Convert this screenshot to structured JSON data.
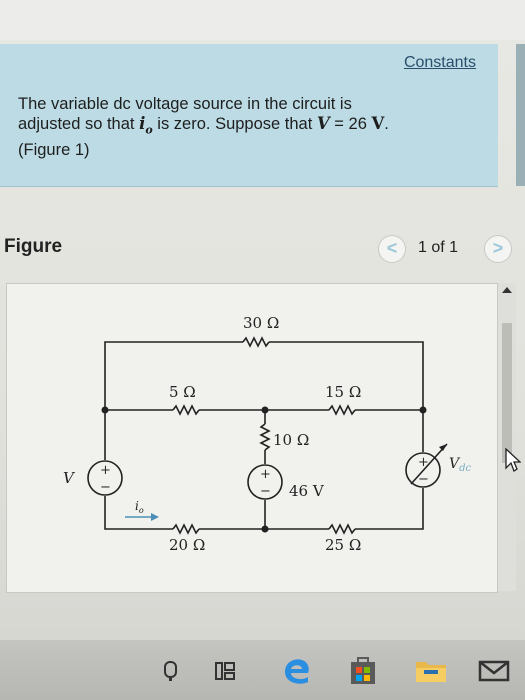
{
  "panel": {
    "constants_link": "Constants",
    "problem_line1": "The variable dc voltage source in the circuit is",
    "problem_line2_a": "adjusted so that ",
    "current_symbol": "i",
    "current_sub": "o",
    "problem_line2_b": " is zero. Suppose that ",
    "voltage_symbol": "V",
    "problem_line2_c": " = 26 ",
    "voltage_unit": "V",
    "problem_line2_d": ".",
    "figure_link": "(Figure 1)"
  },
  "figure": {
    "title": "Figure",
    "prev_glyph": "<",
    "next_glyph": ">",
    "page_indicator": "1 of 1"
  },
  "circuit": {
    "r_top": "30 Ω",
    "r_left_mid": "5 Ω",
    "r_right_mid": "15 Ω",
    "r_center": "10 Ω",
    "r_bottom_left": "20 Ω",
    "r_bottom_right": "25 Ω",
    "source_center": "46 V",
    "source_left": "V",
    "source_right_main": "V",
    "source_right_sub": "dc",
    "current_main": "i",
    "current_sub": "o",
    "plus": "+",
    "minus": "−"
  },
  "taskbar": {
    "icons": [
      "search-icon",
      "task-view-icon",
      "edge-icon",
      "store-icon",
      "file-explorer-icon",
      "mail-icon"
    ]
  }
}
